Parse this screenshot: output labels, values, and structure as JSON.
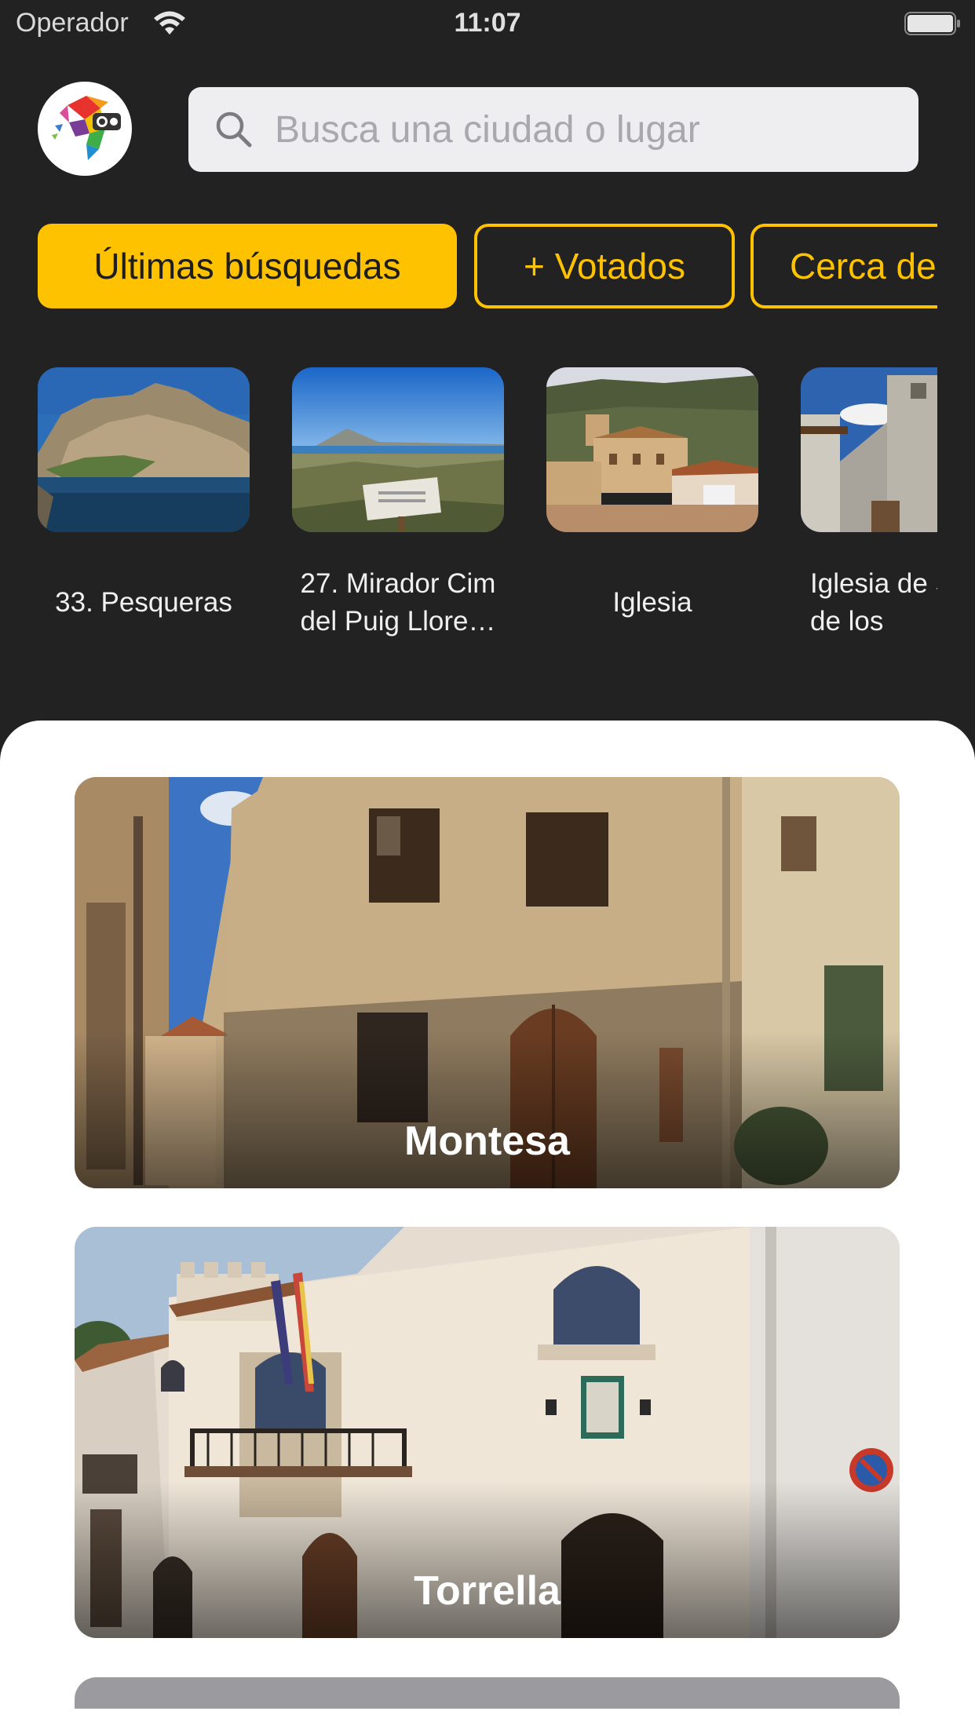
{
  "status_bar": {
    "carrier": "Operador",
    "time": "11:07"
  },
  "search": {
    "placeholder": "Busca una ciudad o lugar",
    "value": ""
  },
  "filters": [
    {
      "label": "Últimas búsquedas",
      "active": true
    },
    {
      "label": "+ Votados",
      "active": false
    },
    {
      "label": "Cerca de",
      "active": false
    }
  ],
  "places": [
    {
      "label": "33. Pesqueras"
    },
    {
      "label": "27. Mirador Cim del Puig Llore…"
    },
    {
      "label": "Iglesia"
    },
    {
      "label": "Iglesia de Sra de los"
    }
  ],
  "cities": [
    {
      "name": "Montesa"
    },
    {
      "name": "Torrella"
    }
  ],
  "colors": {
    "accent": "#fec200",
    "background": "#222223",
    "sheet": "#ffffff"
  }
}
